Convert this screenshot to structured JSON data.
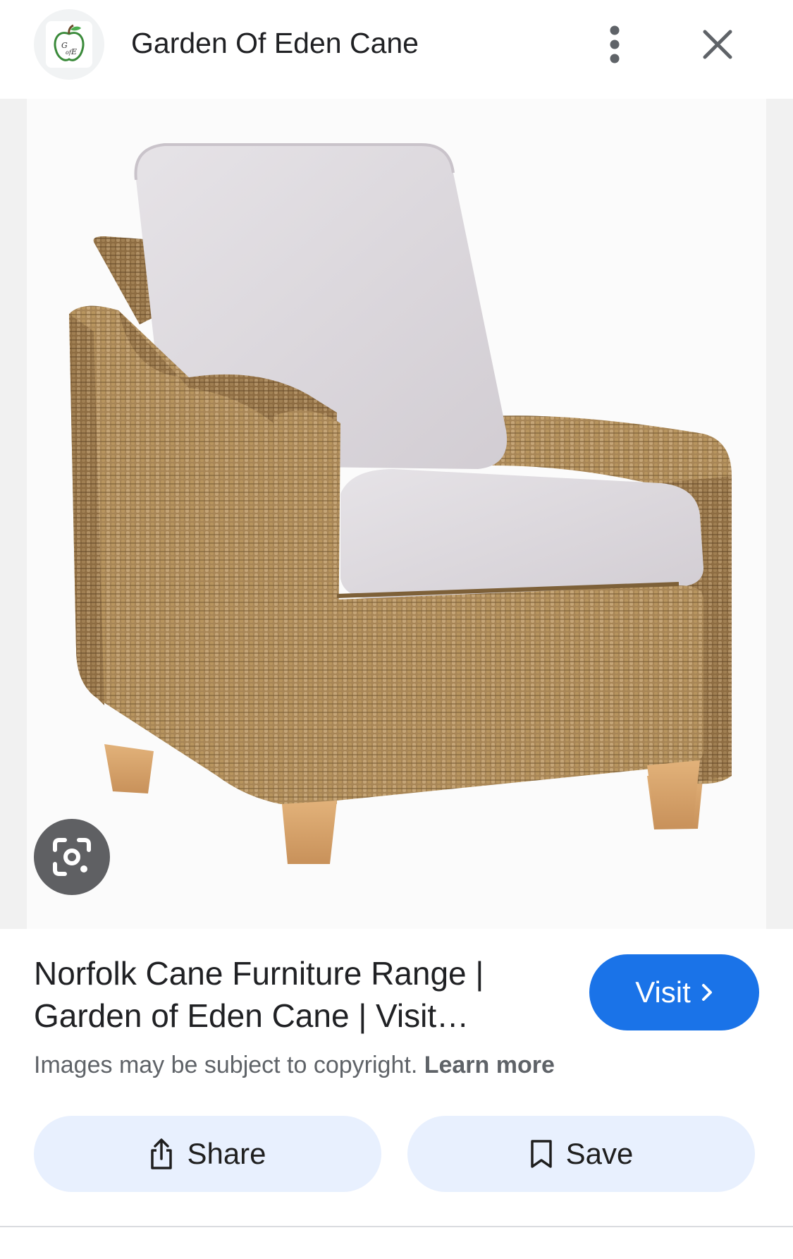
{
  "header": {
    "site_name": "Garden Of Eden Cane",
    "logo_icon": "garden-of-eden-apple-logo",
    "logo_text": "G of E",
    "more_icon": "more-vertical-icon",
    "close_icon": "close-icon"
  },
  "image": {
    "subject_icon": "wicker-armchair-image",
    "lens_icon": "google-lens-icon"
  },
  "result": {
    "title": "Norfolk Cane Furniture Range | Garden of Eden Cane | Visit…",
    "visit_label": "Visit",
    "visit_icon": "chevron-right-icon",
    "copyright_text": "Images may be subject to copyright.",
    "learn_more": "Learn more"
  },
  "actions": {
    "share_label": "Share",
    "share_icon": "share-icon",
    "save_label": "Save",
    "save_icon": "bookmark-icon"
  },
  "colors": {
    "accent": "#1a73e8",
    "action_bg": "#e8f0fe",
    "lens_bg": "#5f6063"
  }
}
